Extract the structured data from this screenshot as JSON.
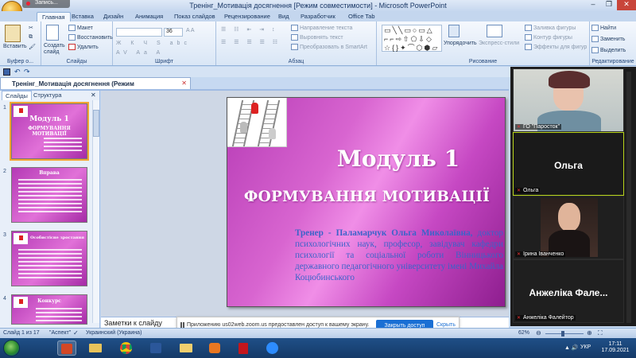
{
  "window": {
    "title": "Тренінг_Мотивація досягнення [Режим совместимости] - Microsoft PowerPoint",
    "recording": "Запись..."
  },
  "ribbon_tabs": [
    "Главная",
    "Вставка",
    "Дизайн",
    "Анимация",
    "Показ слайдов",
    "Рецензирование",
    "Вид",
    "Разработчик",
    "Office Tab"
  ],
  "ribbon": {
    "clipboard": {
      "label": "Буфер о...",
      "paste": "Вставить"
    },
    "slides": {
      "label": "Слайды",
      "new_slide": "Создать слайд",
      "layout": "Макет",
      "reset": "Восстановить",
      "delete": "Удалить"
    },
    "font": {
      "label": "Шрифт",
      "size": "36"
    },
    "paragraph": {
      "label": "Абзац",
      "direction": "Направление текста",
      "align": "Выровнять текст",
      "smartart": "Преобразовать в SmartArt"
    },
    "drawing": {
      "label": "Рисование",
      "arrange": "Упорядочить",
      "quick_styles": "Экспресс-стили",
      "fill": "Заливка фигуры",
      "outline": "Контур фигуры",
      "effects": "Эффекты для фигур"
    },
    "editing": {
      "label": "Редактирование",
      "find": "Найти",
      "replace": "Заменить",
      "select": "Выделить"
    }
  },
  "document_tab": "Тренінг_Мотивація досягнення (Режим совместимости)",
  "panel": {
    "tab_slides": "Слайды",
    "tab_outline": "Структура",
    "thumbs": [
      {
        "num": "1",
        "title": "Модуль 1",
        "subtitle": "ФОРМУВАННЯ МОТИВАЦІЇ"
      },
      {
        "num": "2",
        "title": "Вправа"
      },
      {
        "num": "3",
        "title": "Особистісне зростання"
      },
      {
        "num": "4",
        "title": "Конкурс"
      }
    ]
  },
  "slide": {
    "title": "Модуль 1",
    "subtitle": "ФОРМУВАННЯ МОТИВАЦІЇ",
    "trainer_label": "Тренер - Паламарчук Ольга Миколаївна,",
    "trainer_text": "доктор психологічних наук, професор, завідувач кафедри психології та соціальної роботи Вінницького державного педагогічного університету імені Михайла Коцюбинського"
  },
  "notes_placeholder": "Заметки к слайду",
  "notification": {
    "text": "Приложению us02web.zoom.us предоставлен доступ к вашему экрану.",
    "allow": "Закрыть доступ",
    "hide": "Скрыть"
  },
  "status": {
    "slide": "Слайд 1 из 17",
    "theme": "\"Аспект\"",
    "language": "Украинский (Украина)",
    "zoom": "62%"
  },
  "zoom_participants": [
    {
      "name": "ГО \"Паросток\"",
      "type": "video"
    },
    {
      "name": "Ольга",
      "big": "Ольга",
      "type": "name"
    },
    {
      "name": "Ірина Іванченко",
      "type": "video"
    },
    {
      "name": "Анжеліка Фалейтор",
      "big": "Анжеліка Фале...",
      "type": "name"
    }
  ],
  "taskbar": {
    "lang": "УКР",
    "time": "17:11",
    "date": "17.09.2021"
  }
}
